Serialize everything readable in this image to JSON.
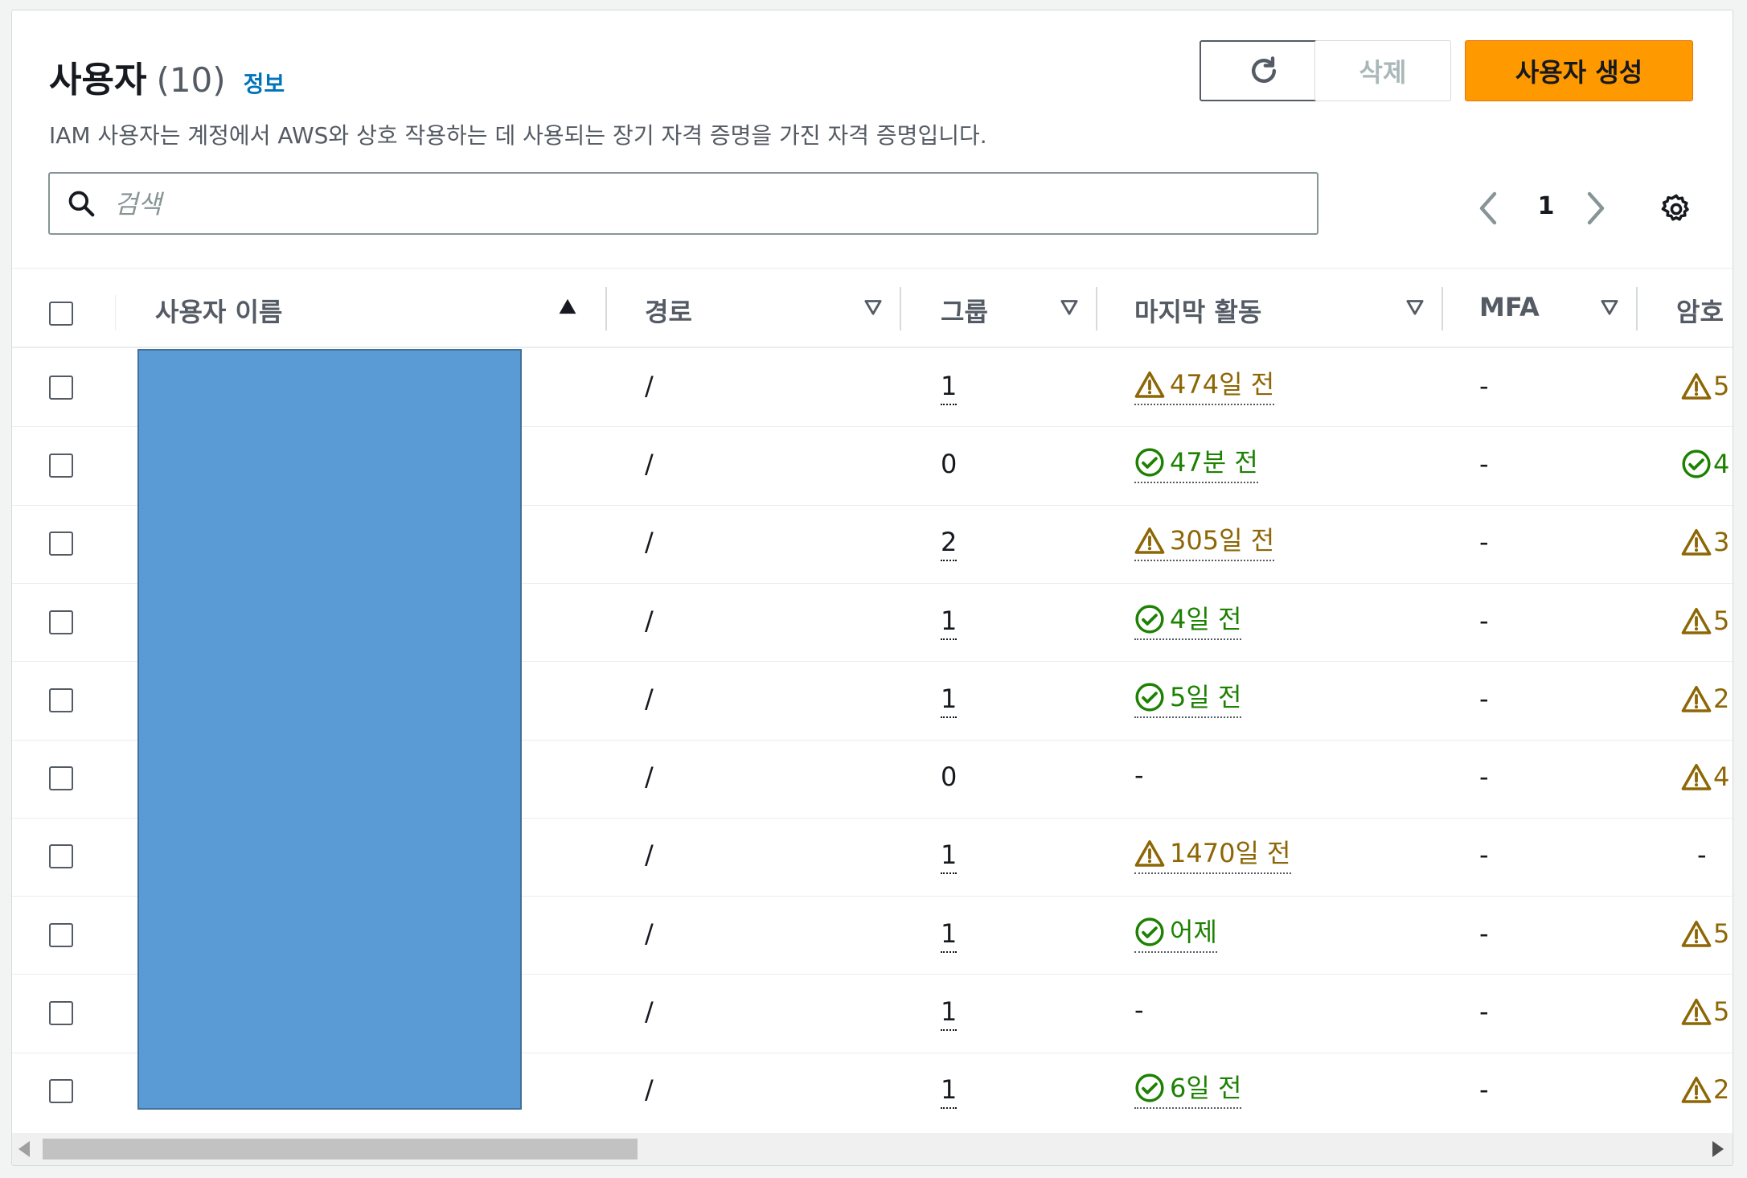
{
  "header": {
    "title": "사용자",
    "count": "(10)",
    "info_link": "정보",
    "description": "IAM 사용자는 계정에서 AWS와 상호 작용하는 데 사용되는 장기 자격 증명을 가진 자격 증명입니다."
  },
  "actions": {
    "refresh_icon": "refresh-icon",
    "delete_label": "삭제",
    "create_label": "사용자 생성"
  },
  "search": {
    "placeholder": "검색",
    "value": ""
  },
  "pagination": {
    "current_page": "1"
  },
  "table": {
    "columns": [
      "사용자 이름",
      "경로",
      "그룹",
      "마지막 활동",
      "MFA",
      "암호"
    ],
    "rows": [
      {
        "path": "/",
        "groups": "1",
        "groups_link": true,
        "activity": "474일 전",
        "activity_status": "warning",
        "mfa": "-",
        "password": "5",
        "password_status": "warning"
      },
      {
        "path": "/",
        "groups": "0",
        "groups_link": false,
        "activity": "47분 전",
        "activity_status": "ok",
        "mfa": "-",
        "password": "4",
        "password_status": "ok"
      },
      {
        "path": "/",
        "groups": "2",
        "groups_link": true,
        "activity": "305일 전",
        "activity_status": "warning",
        "mfa": "-",
        "password": "3",
        "password_status": "warning"
      },
      {
        "path": "/",
        "groups": "1",
        "groups_link": true,
        "activity": "4일 전",
        "activity_status": "ok",
        "mfa": "-",
        "password": "5",
        "password_status": "warning"
      },
      {
        "path": "/",
        "groups": "1",
        "groups_link": true,
        "activity": "5일 전",
        "activity_status": "ok",
        "mfa": "-",
        "password": "2",
        "password_status": "warning"
      },
      {
        "path": "/",
        "groups": "0",
        "groups_link": false,
        "activity": "-",
        "activity_status": "none",
        "mfa": "-",
        "password": "4",
        "password_status": "warning"
      },
      {
        "path": "/",
        "groups": "1",
        "groups_link": true,
        "activity": "1470일 전",
        "activity_status": "warning",
        "mfa": "-",
        "password": "-",
        "password_status": "none"
      },
      {
        "path": "/",
        "groups": "1",
        "groups_link": true,
        "activity": "어제",
        "activity_status": "ok",
        "mfa": "-",
        "password": "5",
        "password_status": "warning"
      },
      {
        "path": "/",
        "groups": "1",
        "groups_link": true,
        "activity": "-",
        "activity_status": "none",
        "mfa": "-",
        "password": "5",
        "password_status": "warning"
      },
      {
        "path": "/",
        "groups": "1",
        "groups_link": true,
        "activity": "6일 전",
        "activity_status": "ok",
        "mfa": "-",
        "password": "2",
        "password_status": "warning"
      }
    ]
  },
  "colors": {
    "primary_button": "#ff9900",
    "link": "#0073bb",
    "warning": "#8d6605",
    "success": "#1d8102",
    "redaction": "#5b9bd5"
  }
}
